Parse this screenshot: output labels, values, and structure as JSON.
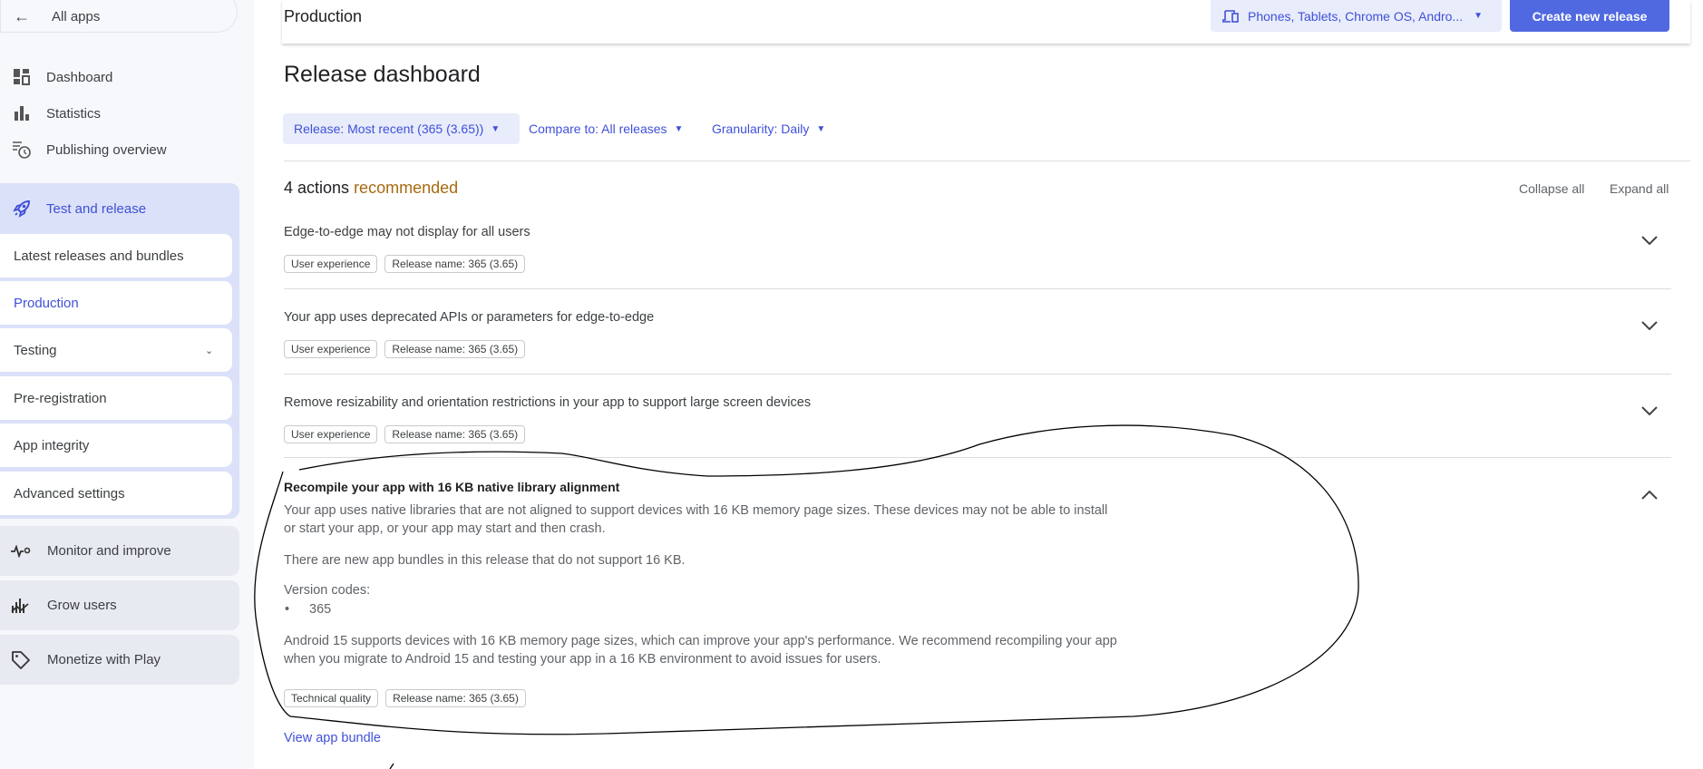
{
  "sidebar": {
    "all_apps": "All apps",
    "nav": [
      {
        "label": "Dashboard",
        "icon": "dashboard-icon"
      },
      {
        "label": "Statistics",
        "icon": "bar-chart-icon"
      },
      {
        "label": "Publishing overview",
        "icon": "publishing-clock-icon"
      }
    ],
    "test_release": {
      "label": "Test and release",
      "icon": "rocket-icon",
      "items": [
        {
          "label": "Latest releases and bundles"
        },
        {
          "label": "Production",
          "active": true
        },
        {
          "label": "Testing"
        },
        {
          "label": "Pre-registration"
        },
        {
          "label": "App integrity"
        },
        {
          "label": "Advanced settings"
        }
      ]
    },
    "sections": [
      {
        "label": "Monitor and improve",
        "icon": "vitals-icon"
      },
      {
        "label": "Grow users",
        "icon": "growth-icon"
      },
      {
        "label": "Monetize with Play",
        "icon": "tag-icon"
      }
    ]
  },
  "header": {
    "title": "Production",
    "device_selector": "Phones, Tablets, Chrome OS, Andro...",
    "create_button": "Create new release"
  },
  "main": {
    "title": "Release dashboard",
    "filters": {
      "release": "Release: Most recent (365 (3.65))",
      "compare": "Compare to: All releases",
      "granularity": "Granularity: Daily"
    },
    "actions_count": "4 actions",
    "actions_suffix": "recommended",
    "collapse_all": "Collapse all",
    "expand_all": "Expand all",
    "items": [
      {
        "title": "Edge-to-edge may not display for all users",
        "chips": [
          "User experience",
          "Release name: 365 (3.65)"
        ]
      },
      {
        "title": "Your app uses deprecated APIs or parameters for edge-to-edge",
        "chips": [
          "User experience",
          "Release name: 365 (3.65)"
        ]
      },
      {
        "title": "Remove resizability and orientation restrictions in your app to support large screen devices",
        "chips": [
          "User experience",
          "Release name: 365 (3.65)"
        ]
      },
      {
        "title": "Recompile your app with 16 KB native library alignment",
        "p1": "Your app uses native libraries that are not aligned to support devices with 16 KB memory page sizes. These devices may not be able to install or start your app, or your app may start and then crash.",
        "p2": "There are new app bundles in this release that do not support 16 KB.",
        "version_label": "Version codes:",
        "version_codes": [
          "365"
        ],
        "p3": "Android 15 supports devices with 16 KB memory page sizes, which can improve your app's performance. We recommend recompiling your app when you migrate to Android 15 and testing your app in a 16 KB environment to avoid issues for users.",
        "chips": [
          "Technical quality",
          "Release name: 365 (3.65)"
        ],
        "link": "View app bundle"
      }
    ]
  },
  "colors": {
    "accent": "#4050d8",
    "button": "#5068e0",
    "recommended": "#a86a10"
  }
}
